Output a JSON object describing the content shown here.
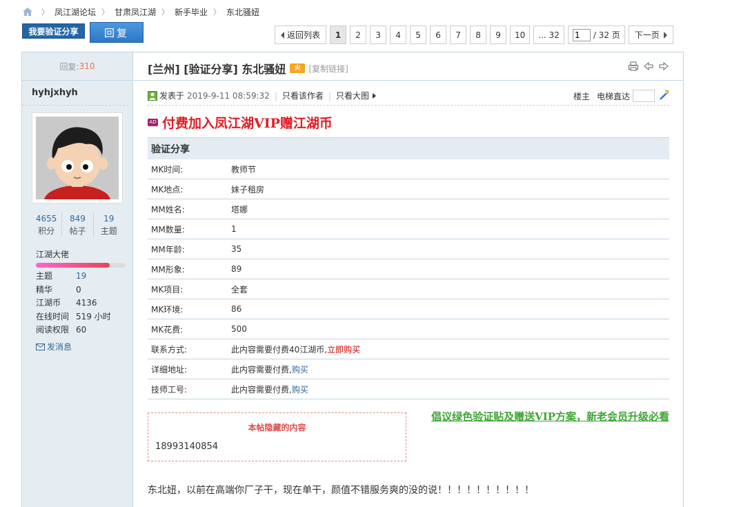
{
  "breadcrumb": {
    "items": [
      "凤江湖论坛",
      "甘肃凤江湖",
      "新手毕业",
      "东北骚妞"
    ]
  },
  "actions": {
    "verify_share_label": "我要验证分享",
    "reply_label": "回复"
  },
  "pager": {
    "back_label": "返回列表",
    "pages": [
      "1",
      "2",
      "3",
      "4",
      "5",
      "6",
      "7",
      "8",
      "9",
      "10",
      "... 32"
    ],
    "current_page": "1",
    "input_value": "1",
    "total_label": "/ 32 页",
    "next_label": "下一页"
  },
  "sidebar": {
    "reply_label": "回复:",
    "reply_count": "310",
    "username": "hyhjxhyh",
    "stats": [
      {
        "value": "4655",
        "label": "积分"
      },
      {
        "value": "849",
        "label": "帖子"
      },
      {
        "value": "19",
        "label": "主题"
      }
    ],
    "rank": "江湖大佬",
    "rank_progress": 0.82,
    "info": [
      {
        "key": "主题",
        "value": "19"
      },
      {
        "key": "精华",
        "value": "0"
      },
      {
        "key": "江湖币",
        "value": "4136"
      },
      {
        "key": "在线时间",
        "value": "519 小时"
      },
      {
        "key": "阅读权限",
        "value": "60"
      }
    ],
    "message_label": "发消息"
  },
  "post": {
    "title": "[兰州] [验证分享] 东北骚妞",
    "hot_badge": "火",
    "copy_link_label": "[复制链接]",
    "posted_label": "发表于",
    "posted_date": "2019-9-11 08:59:32",
    "only_author_label": "只看该作者",
    "big_image_label": "只看大图",
    "floor_label": "楼主",
    "elevator_label": "电梯直达",
    "ad_tag": "AD",
    "ad_text": "付费加入凤江湖VIP赠江湖币",
    "verify_header": "验证分享",
    "verify_rows": [
      {
        "key": "MK时间:",
        "value": "教师节"
      },
      {
        "key": "MK地点:",
        "value": "妹子租房"
      },
      {
        "key": "MM姓名:",
        "value": "塔娜"
      },
      {
        "key": "MM数量:",
        "value": "1"
      },
      {
        "key": "MM年龄:",
        "value": "35"
      },
      {
        "key": "MM形象:",
        "value": "89"
      },
      {
        "key": "MK项目:",
        "value": "全套"
      },
      {
        "key": "MK环境:",
        "value": "86"
      },
      {
        "key": "MK花费:",
        "value": "500"
      }
    ],
    "contact": {
      "key": "联系方式:",
      "text": "此内容需要付费40江湖币,",
      "link": "立即购买"
    },
    "address": {
      "key": "详细地址:",
      "text": "此内容需要付费,",
      "link": "购买"
    },
    "tech_id": {
      "key": "技师工号:",
      "text": "此内容需要付费,",
      "link": "购买"
    },
    "hidden_title": "本帖隐藏的内容",
    "hidden_value": "18993140854",
    "green_link": "倡议绿色验证贴及赠送VIP方案，新老会员升级必看",
    "body": "东北妞，以前在高端你厂子干，现在单干，颜值不错服务爽的没的说！！！！！！！！！！"
  }
}
